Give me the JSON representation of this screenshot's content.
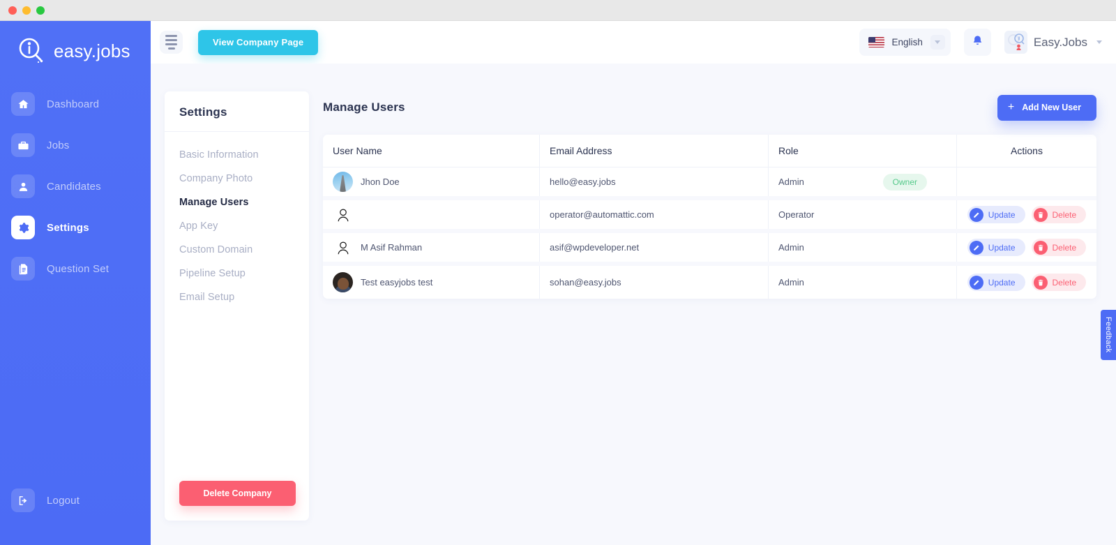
{
  "window": {
    "dots": [
      "red",
      "yellow",
      "green"
    ]
  },
  "brand": {
    "name": "easy.jobs",
    "logo_icon": "easyjobs-magnifier-logo"
  },
  "sidebar": {
    "items": [
      {
        "label": "Dashboard",
        "icon": "home-icon",
        "active": false
      },
      {
        "label": "Jobs",
        "icon": "briefcase-icon",
        "active": false
      },
      {
        "label": "Candidates",
        "icon": "user-icon",
        "active": false
      },
      {
        "label": "Settings",
        "icon": "gear-icon",
        "active": true
      },
      {
        "label": "Question Set",
        "icon": "document-icon",
        "active": false
      }
    ],
    "logout": {
      "label": "Logout",
      "icon": "logout-icon"
    }
  },
  "header": {
    "menu_icon": "hamburger-icon",
    "view_company_label": "View Company Page",
    "language": {
      "label": "English",
      "flag": "us-flag-icon",
      "chevron": "chevron-down-icon"
    },
    "notification_icon": "bell-icon",
    "profile": {
      "name": "Easy.Jobs",
      "avatar": "profile-avatar",
      "chevron": "chevron-down-icon"
    }
  },
  "settings_panel": {
    "title": "Settings",
    "items": [
      {
        "label": "Basic Information",
        "active": false
      },
      {
        "label": "Company Photo",
        "active": false
      },
      {
        "label": "Manage Users",
        "active": true
      },
      {
        "label": "App Key",
        "active": false
      },
      {
        "label": "Custom Domain",
        "active": false
      },
      {
        "label": "Pipeline Setup",
        "active": false
      },
      {
        "label": "Email Setup",
        "active": false
      }
    ],
    "delete_company_label": "Delete Company"
  },
  "main": {
    "title": "Manage Users",
    "add_user_label": "Add New User",
    "add_user_icon": "plus-icon",
    "columns": [
      "User Name",
      "Email Address",
      "Role",
      "Actions"
    ],
    "rows": [
      {
        "name": "Jhon Doe",
        "email": "hello@easy.jobs",
        "role": "Admin",
        "avatar": "photo1",
        "badge": "Owner",
        "actions": []
      },
      {
        "name": "",
        "email": "operator@automattic.com",
        "role": "Operator",
        "avatar": "blank",
        "badge": "",
        "actions": [
          "Update",
          "Delete"
        ]
      },
      {
        "name": "M Asif Rahman",
        "email": "asif@wpdeveloper.net",
        "role": "Admin",
        "avatar": "blank",
        "badge": "",
        "actions": [
          "Update",
          "Delete"
        ]
      },
      {
        "name": "Test easyjobs test",
        "email": "sohan@easy.jobs",
        "role": "Admin",
        "avatar": "photo2",
        "badge": "",
        "actions": [
          "Update",
          "Delete"
        ]
      }
    ],
    "action_labels": {
      "update": "Update",
      "delete": "Delete"
    },
    "action_icons": {
      "update": "pencil-icon",
      "delete": "trash-icon"
    }
  },
  "feedback": {
    "label": "Feedback"
  },
  "colors": {
    "sidebar": "#4d6cf5",
    "accent_blue": "#4d6cf5",
    "cyan": "#2ec5e8",
    "danger": "#fb5f72",
    "success": "#54c98a",
    "page_bg": "#f7f8fd"
  }
}
